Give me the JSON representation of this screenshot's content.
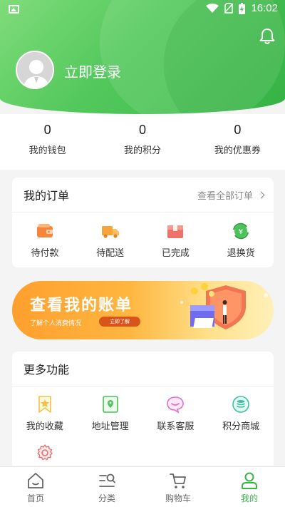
{
  "status_bar": {
    "time": "16:02"
  },
  "profile": {
    "login_text": "立即登录"
  },
  "stats": [
    {
      "value": "0",
      "label": "我的钱包"
    },
    {
      "value": "0",
      "label": "我的积分"
    },
    {
      "value": "0",
      "label": "我的优惠券"
    }
  ],
  "orders": {
    "title": "我的订单",
    "view_all": "查看全部订单",
    "items": [
      {
        "label": "待付款",
        "icon": "wallet-icon"
      },
      {
        "label": "待配送",
        "icon": "truck-icon"
      },
      {
        "label": "已完成",
        "icon": "box-icon"
      },
      {
        "label": "退换货",
        "icon": "exchange-icon"
      }
    ]
  },
  "banner": {
    "title": "查看我的账单",
    "subtitle": "了解个人消费情况",
    "button": "立即了解"
  },
  "more": {
    "title": "更多功能",
    "items": [
      {
        "label": "我的收藏",
        "icon": "bookmark-star-icon"
      },
      {
        "label": "地址管理",
        "icon": "map-pin-icon"
      },
      {
        "label": "联系客服",
        "icon": "chat-bubble-icon"
      },
      {
        "label": "积分商城",
        "icon": "coin-stack-icon"
      },
      {
        "label": "",
        "icon": "gear-icon"
      }
    ]
  },
  "tabbar": {
    "items": [
      {
        "label": "首页",
        "icon": "home-icon"
      },
      {
        "label": "分类",
        "icon": "category-search-icon"
      },
      {
        "label": "购物车",
        "icon": "cart-icon"
      },
      {
        "label": "我的",
        "icon": "user-icon"
      }
    ],
    "active": "我的"
  },
  "colors": {
    "brand_green": "#3ab54a",
    "header_gradient_start": "#7fdc7a",
    "banner_orange": "#ff9f2e",
    "order_icon_orange": "#f28a3a"
  }
}
